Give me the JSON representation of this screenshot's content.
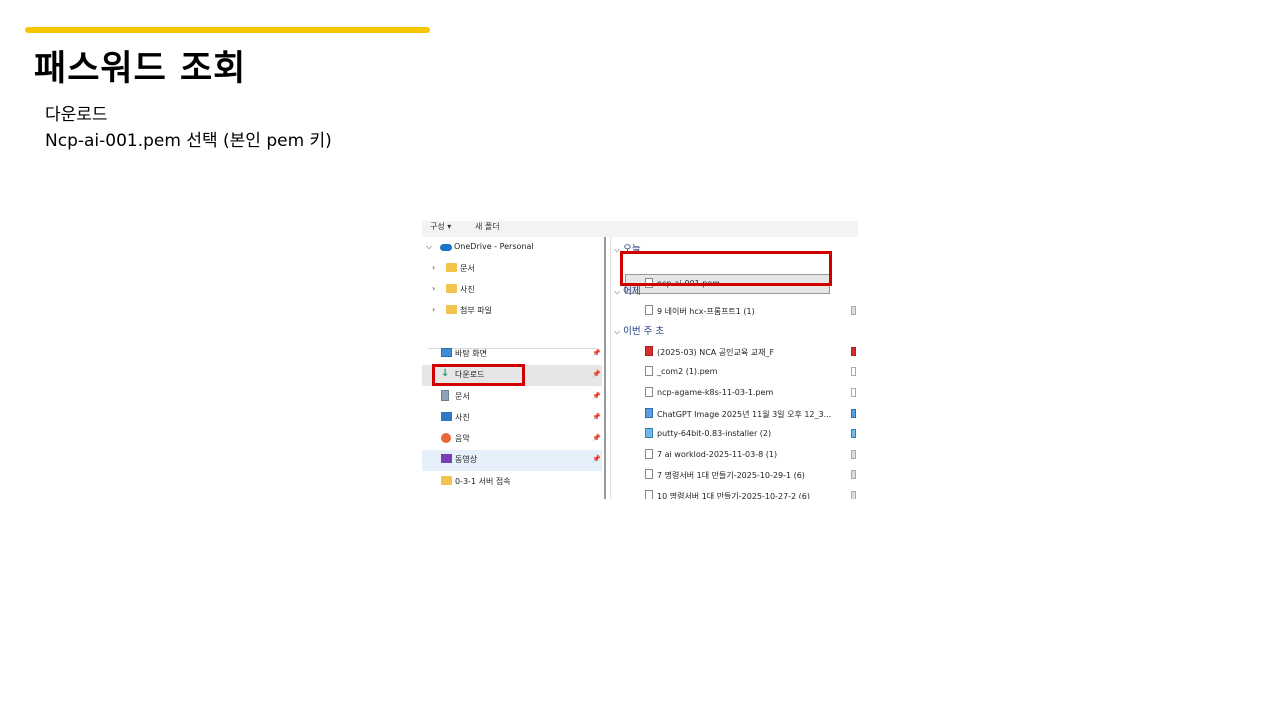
{
  "slide": {
    "title": "패스워드 조회",
    "line1": "다운로드",
    "line2": "Ncp-ai-001.pem 선택  (본인 pem 키)",
    "accent_color": "#f6c600",
    "highlight_color": "#d00000"
  },
  "explorer": {
    "toolbar": {
      "organize": "구성 ▾",
      "new_folder": "새 폴더"
    },
    "nav": {
      "onedrive": "OneDrive - Personal",
      "onedrive_children": [
        "문서",
        "사진",
        "첨부 파일"
      ],
      "quick": [
        {
          "label": "바탕 화면",
          "icon": "desktop-icon"
        },
        {
          "label": "다운로드",
          "icon": "download-icon"
        },
        {
          "label": "문서",
          "icon": "document-icon"
        },
        {
          "label": "사진",
          "icon": "pictures-icon"
        },
        {
          "label": "음악",
          "icon": "music-icon"
        },
        {
          "label": "동영상",
          "icon": "video-icon"
        },
        {
          "label": "0-3-1 서버 접속",
          "icon": "folder-icon"
        }
      ]
    },
    "groups": {
      "today": "오늘",
      "yesterday": "어제",
      "this_week": "이번 주 초"
    },
    "files": {
      "today": [
        "ncp-ai-001.pem"
      ],
      "yesterday": [
        "9 네이버 hcx-프롬프트1 (1)"
      ],
      "this_week": [
        "(2025-03) NCA 공인교육 교재_F",
        "_com2 (1).pem",
        "ncp-agame-k8s-11-03-1.pem",
        "ChatGPT Image 2025년 11월 3일 오후 12_3...",
        "putty-64bit-0.83-installer (2)",
        "7 ai worklod-2025-11-03-8 (1)",
        "7 명령서버 1대 만들기-2025-10-29-1 (6)",
        "10 명령서버 1대 만들기-2025-10-27-2 (6)"
      ]
    }
  }
}
